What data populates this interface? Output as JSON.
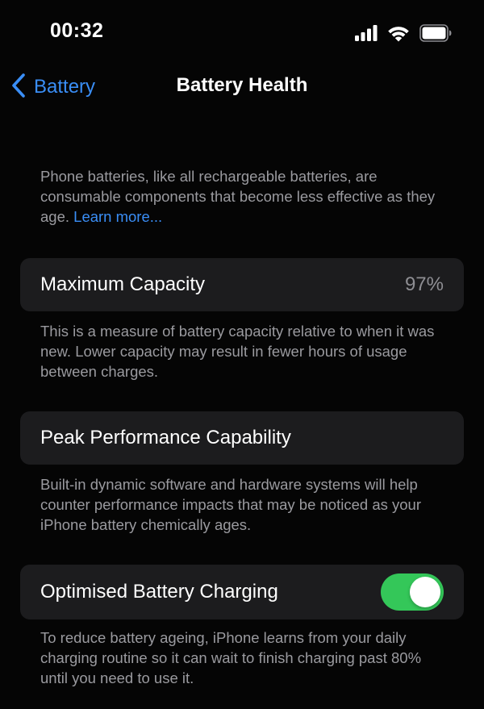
{
  "status_bar": {
    "time": "00:32",
    "icons": [
      "cellular-signal-icon",
      "wifi-icon",
      "battery-icon"
    ]
  },
  "nav": {
    "back_label": "Battery",
    "back_icon": "chevron-left-icon",
    "title": "Battery Health"
  },
  "intro": {
    "text": "Phone batteries, like all rechargeable batteries, are consumable components that become less effective as they age.",
    "link_label": "Learn more..."
  },
  "maximum_capacity": {
    "label": "Maximum Capacity",
    "value": "97%",
    "footer": "This is a measure of battery capacity relative to when it was new. Lower capacity may result in fewer hours of usage between charges."
  },
  "peak_performance": {
    "label": "Peak Performance Capability",
    "footer": "Built-in dynamic software and hardware systems will help counter performance impacts that may be noticed as your iPhone battery chemically ages."
  },
  "optimised_charging": {
    "label": "Optimised Battery Charging",
    "enabled": true,
    "footer": "To reduce battery ageing, iPhone learns from your daily charging routine so it can wait to finish charging past 80% until you need to use it."
  },
  "colors": {
    "background": "#050505",
    "cell_background": "#1c1c1e",
    "accent_blue": "#3a8ef6",
    "toggle_on": "#34c759",
    "secondary_text": "#9a9a9f"
  }
}
